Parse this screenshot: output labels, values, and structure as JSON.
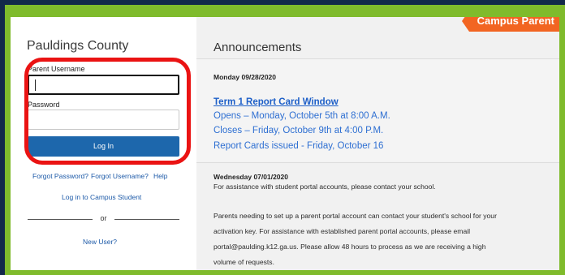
{
  "brand_tab": "Campus Parent",
  "login": {
    "district": "Pauldings County",
    "username_label": "Parent Username",
    "username_value": "",
    "password_label": "Password",
    "password_value": "",
    "login_button": "Log In",
    "forgot_password": "Forgot Password?",
    "forgot_username": "Forgot Username?",
    "help": "Help",
    "campus_student": "Log in to Campus Student",
    "or": "or",
    "new_user": "New User?"
  },
  "announcements": {
    "title": "Announcements",
    "items": [
      {
        "date": "Monday 09/28/2020",
        "headline": "Term 1 Report Card Window",
        "lines": [
          "Opens – Monday, October 5th at 8:00 A.M.",
          "Closes – Friday, October 9th at 4:00 P.M.",
          "Report Cards issued - Friday, October 16"
        ]
      },
      {
        "date": "Wednesday 07/01/2020",
        "lines": [
          "For assistance with student portal accounts, please contact your school.",
          "Parents needing to set up a parent portal account can contact your student's school for your",
          "activation key.  For assistance with established parent portal accounts, please email",
          "portal@paulding.k12.ga.us.  Please allow 48 hours to process  as we are receiving a high",
          "volume of requests."
        ]
      }
    ]
  },
  "colors": {
    "accent_green": "#7fbb2c",
    "brand_orange": "#f26522",
    "button_blue": "#1d67ac",
    "highlight_red": "#ea1313"
  }
}
